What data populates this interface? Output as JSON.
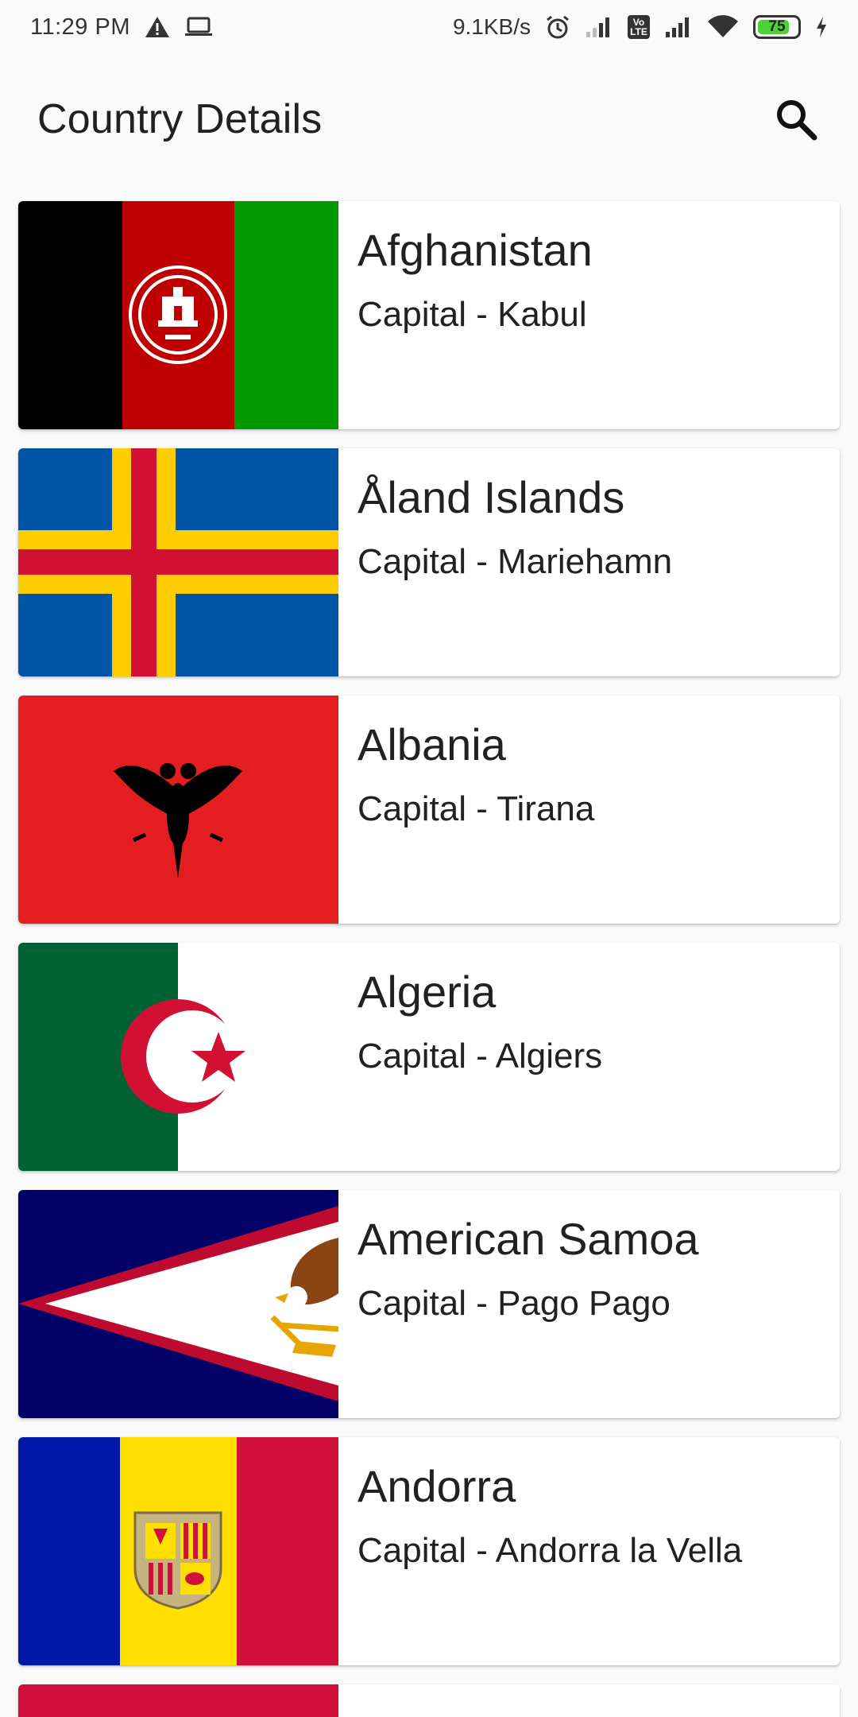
{
  "status_bar": {
    "time": "11:29 PM",
    "network_speed": "9.1KB/s",
    "volte_label": "Vo LTE",
    "battery_level": "75",
    "icons": [
      "warning-icon",
      "laptop-icon",
      "alarm-icon",
      "signal-icon",
      "volte-icon",
      "signal-icon",
      "wifi-icon",
      "battery-icon",
      "charging-icon"
    ]
  },
  "app_bar": {
    "title": "Country Details",
    "search_icon": "search-icon"
  },
  "countries": [
    {
      "name": "Afghanistan",
      "capital": "Capital - Kabul"
    },
    {
      "name": "Åland Islands",
      "capital": "Capital - Mariehamn"
    },
    {
      "name": "Albania",
      "capital": "Capital - Tirana"
    },
    {
      "name": "Algeria",
      "capital": "Capital - Algiers"
    },
    {
      "name": "American Samoa",
      "capital": "Capital - Pago Pago"
    },
    {
      "name": "Andorra",
      "capital": "Capital - Andorra la Vella"
    }
  ],
  "colors": {
    "background": "#fafafa",
    "card": "#ffffff",
    "text": "#212121",
    "battery_fill": "#4cd137"
  }
}
